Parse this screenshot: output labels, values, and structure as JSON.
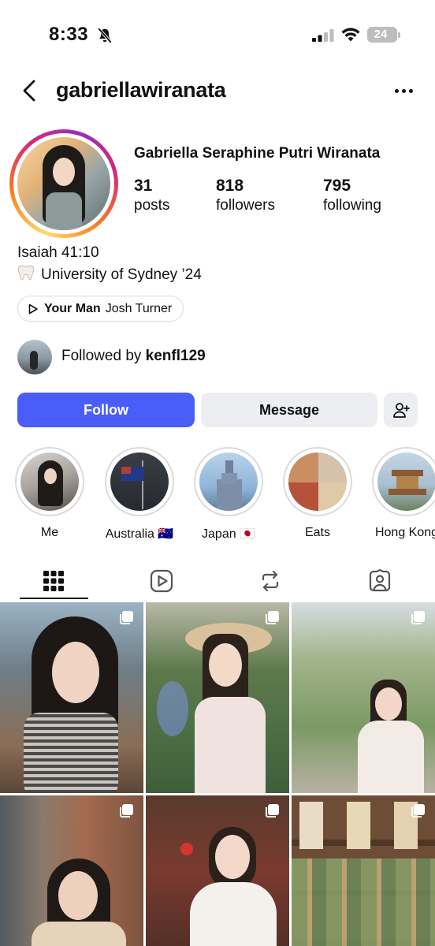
{
  "status_bar": {
    "time": "8:33",
    "battery": "24",
    "icons": [
      "bell-slash-icon",
      "cellular-signal-icon",
      "wifi-icon",
      "battery-icon"
    ]
  },
  "header": {
    "username": "gabriellawiranata",
    "back_icon": "chevron-left-icon",
    "more_icon": "ellipsis-icon"
  },
  "profile": {
    "full_name": "Gabriella Seraphine Putri Wiranata",
    "stats": {
      "posts": {
        "value": "31",
        "label": "posts"
      },
      "followers": {
        "value": "818",
        "label": "followers"
      },
      "following": {
        "value": "795",
        "label": "following"
      }
    },
    "bio": {
      "line1": "Isaiah 41:10",
      "line2": "University of Sydney ’24",
      "line2_icon": "tooth-emoji"
    },
    "music": {
      "title": "Your Man",
      "artist": "Josh Turner",
      "icon": "play-icon"
    },
    "followed_by": {
      "prefix": "Followed by",
      "user": "kenfl129"
    }
  },
  "actions": {
    "follow": "Follow",
    "message": "Message",
    "add_user_icon": "person-add-icon"
  },
  "highlights": [
    {
      "label": "Me"
    },
    {
      "label": "Australia 🇦🇺"
    },
    {
      "label": "Japan 🇯🇵"
    },
    {
      "label": "Eats"
    },
    {
      "label": "Hong Kong"
    }
  ],
  "tabs": [
    {
      "name": "grid",
      "icon": "grid-icon",
      "active": true
    },
    {
      "name": "reels",
      "icon": "reels-icon",
      "active": false
    },
    {
      "name": "reposts",
      "icon": "repost-icon",
      "active": false
    },
    {
      "name": "tagged",
      "icon": "tagged-person-icon",
      "active": false
    }
  ],
  "colors": {
    "accent": "#4a5df9",
    "secondary_button": "#eceef1",
    "text": "#111111",
    "border": "#dbdbdb"
  }
}
